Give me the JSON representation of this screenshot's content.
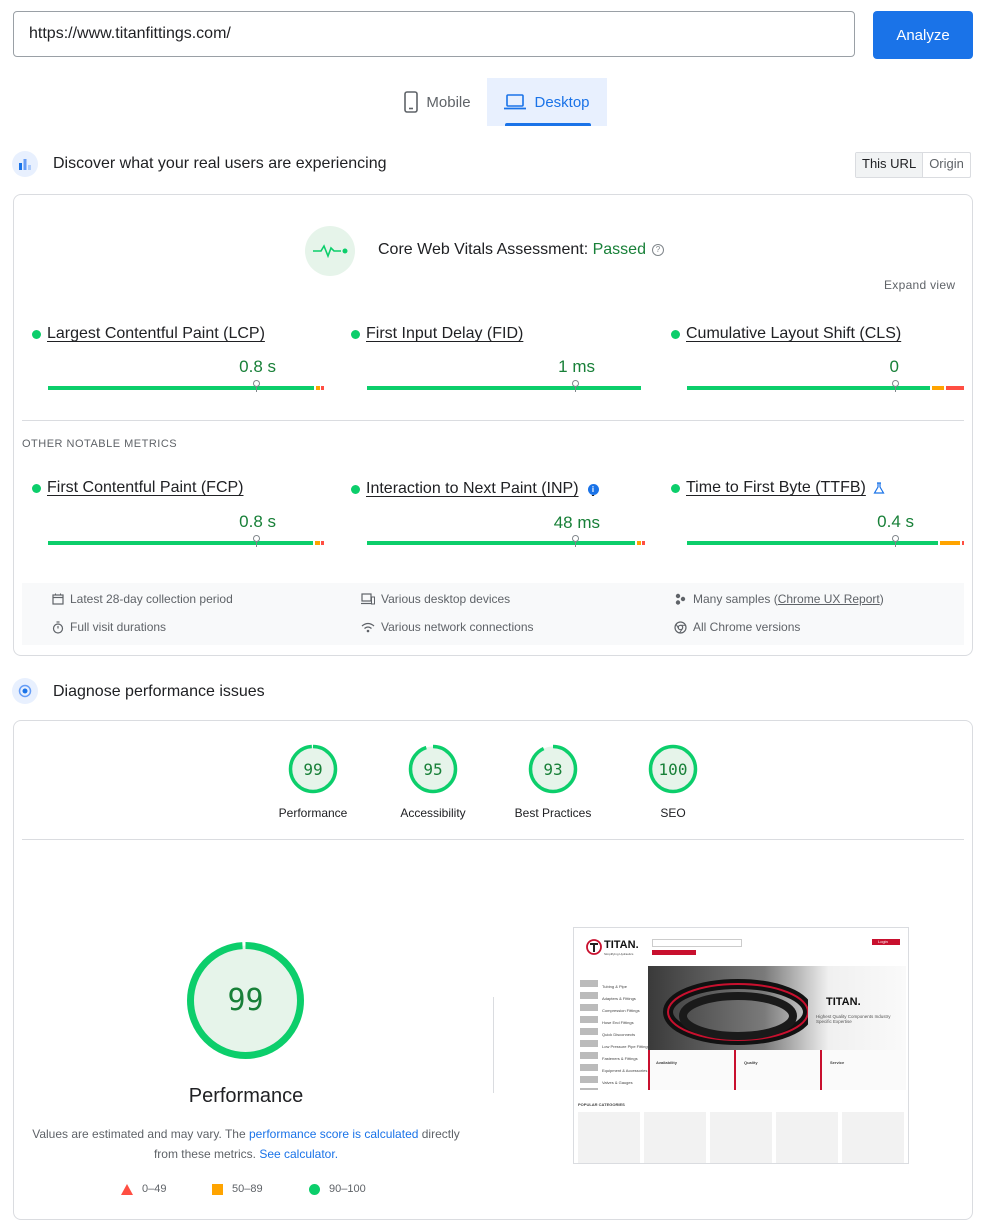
{
  "url_bar": {
    "value": "https://www.titanfittings.com/",
    "analyze_label": "Analyze"
  },
  "device_tabs": {
    "mobile": "Mobile",
    "desktop": "Desktop",
    "selected": "desktop"
  },
  "field_section": {
    "title": "Discover what your real users are experiencing",
    "toggle": {
      "this_url": "This URL",
      "origin": "Origin",
      "selected": "this_url"
    }
  },
  "cwv": {
    "assessment_label": "Core Web Vitals Assessment: ",
    "assessment_status": "Passed",
    "help_glyph": "?",
    "expand_label": "Expand view",
    "core_metrics": [
      {
        "name": "Largest Contentful Paint (LCP)",
        "value": "0.8 s",
        "status": "good"
      },
      {
        "name": "First Input Delay (FID)",
        "value": "1 ms",
        "status": "good"
      },
      {
        "name": "Cumulative Layout Shift (CLS)",
        "value": "0",
        "status": "good"
      }
    ],
    "other_label": "OTHER NOTABLE METRICS",
    "other_metrics": [
      {
        "name": "First Contentful Paint (FCP)",
        "value": "0.8 s",
        "status": "good"
      },
      {
        "name": "Interaction to Next Paint (INP)",
        "value": "48 ms",
        "status": "good",
        "info_glyph": "i"
      },
      {
        "name": "Time to First Byte (TTFB)",
        "value": "0.4 s",
        "status": "good"
      }
    ],
    "footer": {
      "period": "Latest 28-day collection period",
      "durations": "Full visit durations",
      "devices": "Various desktop devices",
      "network": "Various network connections",
      "samples_prefix": "Many samples (",
      "samples_link": "Chrome UX Report",
      "samples_suffix": ")",
      "versions": "All Chrome versions"
    }
  },
  "lab_section": {
    "title": "Diagnose performance issues",
    "gauges": [
      {
        "label": "Performance",
        "score": "99",
        "value": 99
      },
      {
        "label": "Accessibility",
        "score": "95",
        "value": 95
      },
      {
        "label": "Best Practices",
        "score": "93",
        "value": 93
      },
      {
        "label": "SEO",
        "score": "100",
        "value": 100
      }
    ],
    "big_gauge": {
      "score": "99",
      "value": 99,
      "label": "Performance"
    },
    "note": {
      "part1": "Values are estimated and may vary. The ",
      "link1": "performance score is calculated",
      "part2": " directly from these metrics. ",
      "link2": "See calculator."
    },
    "legend": [
      {
        "range": "0–49",
        "color": "#ff4e42",
        "shape": "triangle"
      },
      {
        "range": "50–89",
        "color": "#ffa400",
        "shape": "square"
      },
      {
        "range": "90–100",
        "color": "#0cce6b",
        "shape": "circle"
      }
    ]
  },
  "screenshot_thumb": {
    "brand": "TITAN.",
    "tagline": "Simplifying Hydraulics",
    "login": "Login",
    "nav": [
      "Tubing & Pipe",
      "Adapters & Fittings",
      "Compression Fittings",
      "Hose End Fittings",
      "Quick Disconnects",
      "Low Pressure Pipe Fittings",
      "Fasteners & Fittings",
      "Equipment & Accessories",
      "Valves & Gauges"
    ],
    "hero_text": "Highest Quality Components Industry Specific Expertise",
    "features": [
      "Availability",
      "Quality",
      "Service"
    ],
    "categories_label": "POPULAR CATEGORIES",
    "colors": {
      "brand_red": "#c8102e",
      "good": "#0cce6b",
      "average": "#ffa400",
      "poor": "#ff4e42",
      "accent": "#1a73e8"
    }
  }
}
